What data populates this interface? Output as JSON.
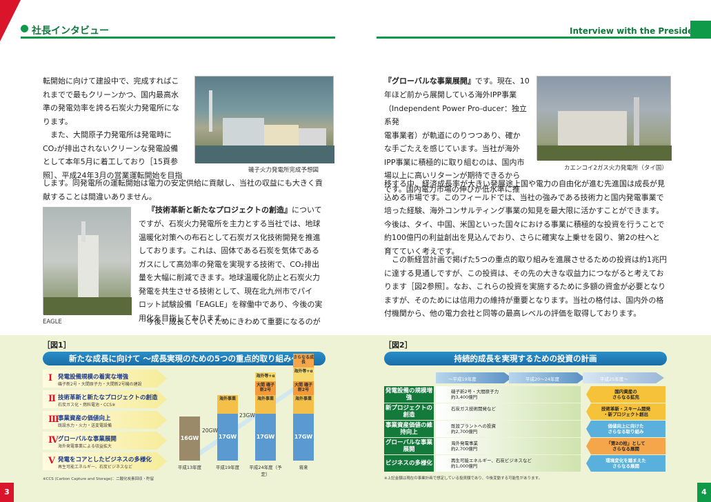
{
  "header": {
    "left_title": "社長インタビュー",
    "right_title": "Interview with the President"
  },
  "left_page": {
    "para1": "転開始に向けて建設中で、完成すればこ\nれまでで最もクリーンかつ、国内最高水\n準の発電効率を誇る石炭火力発電所にな\nります。",
    "para2": "　また、大間原子力発電所は発電時に\nCO₂が排出されないクリーンな発電設備\nとして本年5月に着工しており［15頁参\n照］、平成24年3月の営業運転開始を目指",
    "para2b": "します。同発電所の運転開始は電力の安定供給に貢献し、当社の収益にも大きく貢\n献することは間違いありません。",
    "para3_title": "『技術革新と新たなプロジェクトの創造』",
    "para3_tail": "について",
    "para3": "ですが、石炭火力発電所を主力とする当社では、地球\n温暖化対策への布石として石炭ガス化技術開発を推進\nしております。これは、固体である石炭を気体である\nガスにして高効率の発電を実現する技術で、CO₂排出\n量を大幅に削減できます。地球温暖化防止と石炭火力\n発電を共生させる技術として、現在北九州市でパイ\nロット試験設備「EAGLE」を稼働中であり、今後の実\n用化を目指しております。",
    "para4": "　今後、成長していくためにきわめて重要になるのが",
    "photo1_caption": "磯子火力発電所完成予想図",
    "photo2_caption": "EAGLE",
    "page_number": "3"
  },
  "right_page": {
    "para1_title": "『グローバルな事業展開』",
    "para1_tail": "です。現在、10",
    "para1": "年ほど前から展開している海外IPP事業\n（Independent Power Pro-ducer：独立系発\n電事業者）が軌道にのりつつあり、確か\nな手ごたえを感じています。当社が海外\nIPP事業に積極的に取り組むのは、国内市\n場以上に高いリターンが期待できるから\nです。国内電力市場の伸びが低水準に推",
    "para1b": "移する中、経済成長率が大きい発展途上国や電力の自由化が進む先進国は成長が見\n込める市場です。このフィールドでは、当社の強みである技術力と国内発電事業で\n培った経験、海外コンサルティング事業の知見を最大限に活かすことができます。\n今後は、タイ、中国、米国といった国々における事業に積極的な投資を行うことで\n約100億円の利益創出を見込んでおり、さらに確実な上乗せを図り、第2の柱へと\n育てていく考えです。",
    "para2": "　この新経営計画で掲げた5つの重点的取り組みを進展させるための投資は約1兆円\nに達する見通しですが、この投資は、その先の大きな収益力につながると考えてお\nります［図2参照］。なお、これらの投資を実施するために多額の資金が必要となり\nますが、そのためには信用力の維持が重要となります。当社の格付は、国内外の格\n付機関から、他の電力会社と同等の最高レベルの評価を取得しております。",
    "photo_caption": "カエンコイ2ガス火力発電所（タイ国）",
    "page_number": "4"
  },
  "figure1": {
    "tag": "［図1］",
    "banner": "新たな成長に向けて ～成長実現のための5つの重点的取り組み～",
    "items": [
      {
        "roman": "Ⅰ",
        "title": "発電設備規模の着実な増強",
        "sub": "磯子新2号・大間原子力・大間新2号機の建設"
      },
      {
        "roman": "Ⅱ",
        "title": "技術革新と新たなプロジェクトの創造",
        "sub": "石炭ガス化・燃料電池・CCS※"
      },
      {
        "roman": "Ⅲ",
        "title": "事業資産の価値向上",
        "sub": "既設水力・火力・送変電設備"
      },
      {
        "roman": "Ⅳ",
        "title": "グローバルな事業展開",
        "sub": "海外発電事業による収益拡大"
      },
      {
        "roman": "Ⅴ",
        "title": "発電をコアとしたビジネスの多様化",
        "sub": "再生可能エネルギー、石炭ビジネスなど"
      }
    ],
    "note": "※CCS (Carbon Capture and Storage)：二酸化炭素回収・貯留",
    "chart_data": {
      "type": "bar",
      "categories": [
        "平成13年度",
        "平成19年度",
        "平成24年度（予定）",
        "将来"
      ],
      "totals": [
        "20GW",
        "23GW",
        "さらなる成長"
      ],
      "base_label": [
        "16GW",
        "17GW",
        "17GW",
        "17GW"
      ],
      "base_values": [
        16,
        17,
        17,
        17
      ],
      "segments": [
        [],
        [
          {
            "label": "海外事業",
            "value": 3
          }
        ],
        [
          {
            "label": "海外事業",
            "value": 3
          },
          {
            "label": "大間 磯子新2号",
            "value": 2
          },
          {
            "label": "海外等+α",
            "value": 1
          }
        ],
        [
          {
            "label": "海外事業",
            "value": 3
          },
          {
            "label": "大間 磯子新2号",
            "value": 2
          },
          {
            "label": "海外等+α",
            "value": 2
          },
          {
            "label": "さらなる成長",
            "value": 2
          }
        ]
      ]
    }
  },
  "figure2": {
    "tag": "［図2］",
    "banner": "持続的成長を実現するための投資の計画",
    "timeline": [
      "～平成19年度",
      "平成20～24年度",
      "平成25年度～"
    ],
    "rows": [
      {
        "label": "発電設備の規模増強",
        "text": "磯子新2号・大間原子力\n約3,400億円",
        "result": "国内資産の\nさらなる拡充"
      },
      {
        "label": "新プロジェクトの創造",
        "text": "石炭ガス技術開発など",
        "result": "技術革新・スキーム開発\n・新プロジェクト創出"
      },
      {
        "label": "事業資産価値の維持向上",
        "text": "既設プラントへの投資\n約2,700億円",
        "result": "価値向上に向けた\nさらなる取り組み"
      },
      {
        "label": "グローバルな事業展開",
        "text": "海外発電事業\n約2,700億円",
        "result": "「第2の柱」として\nさらなる展開"
      },
      {
        "label": "ビジネスの多様化",
        "text": "再生可能エネルギー、石炭ビジネスなど\n約1,000億円",
        "result": "環境変化を踏まえた\nさらなる展開"
      }
    ],
    "note": "※上記金額は現在の事業計画で想定している投資額であり、今後変動する可能性があります。"
  },
  "colors": {
    "green": "#0f9a4a",
    "red": "#d9142b",
    "blue": "#1a6ea8"
  }
}
